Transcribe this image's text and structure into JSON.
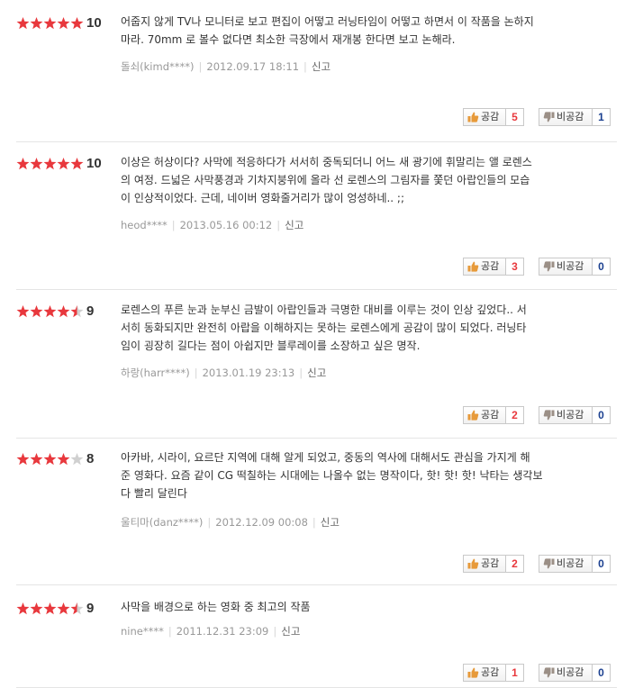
{
  "colors": {
    "star_on": "#e8383d",
    "star_off": "#d0d0d0",
    "like_count": "#e8383d",
    "dislike_count": "#1a3f8f"
  },
  "icons": {
    "like": "thumbs-up-icon",
    "dislike": "thumbs-down-icon",
    "star": "star-icon"
  },
  "labels": {
    "like": "공감",
    "dislike": "비공감",
    "report": "신고"
  },
  "reviews": [
    {
      "stars": 5,
      "score": "10",
      "lines": [
        "어줍지 않게 TV나 모니터로 보고 편집이 어떻고 러닝타임이 어떻고 하면서 이 작품을 논하지",
        "마라. 70mm 로 볼수 없다면 최소한 극장에서 재개봉 한다면 보고 논해라."
      ],
      "author": "돌쇠(kimd****)",
      "date": "2012.09.17 18:11",
      "like": "5",
      "dislike": "1"
    },
    {
      "stars": 5,
      "score": "10",
      "lines": [
        "이상은 허상이다? 사막에 적응하다가 서서히 중독되더니 어느 새 광기에 휘말리는 앨 로렌스",
        "의 여정. 드넓은 사막풍경과 기차지붕위에 올라 선 로렌스의 그림자를 쫓던 아랍인들의 모습",
        "이 인상적이었다. 근데, 네이버 영화줄거리가 많이 엉성하네.. ;;"
      ],
      "author": "heod****",
      "date": "2013.05.16 00:12",
      "like": "3",
      "dislike": "0"
    },
    {
      "stars": 4.5,
      "score": "9",
      "lines": [
        "로렌스의 푸른 눈과 눈부신 금발이 아랍인들과 극명한 대비를 이루는 것이 인상 깊었다.. 서",
        "서히 동화되지만 완전히 아랍을 이해하지는 못하는 로렌스에게 공감이 많이 되었다. 러닝타",
        "임이 굉장히 길다는 점이 아쉽지만 블루레이를 소장하고 싶은 명작."
      ],
      "author": "하랑(harr****)",
      "date": "2013.01.19 23:13",
      "like": "2",
      "dislike": "0"
    },
    {
      "stars": 4,
      "score": "8",
      "lines": [
        "아카바, 시라이, 요르단 지역에 대해 알게 되었고, 중동의 역사에 대해서도 관심을 가지게 해",
        "준 영화다. 요즘 같이 CG 떡칠하는 시대에는 나올수 없는 명작이다, 핫! 핫! 핫! 낙타는 생각보",
        "다 빨리 달린다"
      ],
      "author": "울티마(danz****)",
      "date": "2012.12.09 00:08",
      "like": "2",
      "dislike": "0"
    },
    {
      "stars": 4.5,
      "score": "9",
      "lines": [
        "사막을 배경으로 하는 영화 중 최고의 작품"
      ],
      "author": "nine****",
      "date": "2011.12.31 23:09",
      "like": "1",
      "dislike": "0"
    }
  ]
}
